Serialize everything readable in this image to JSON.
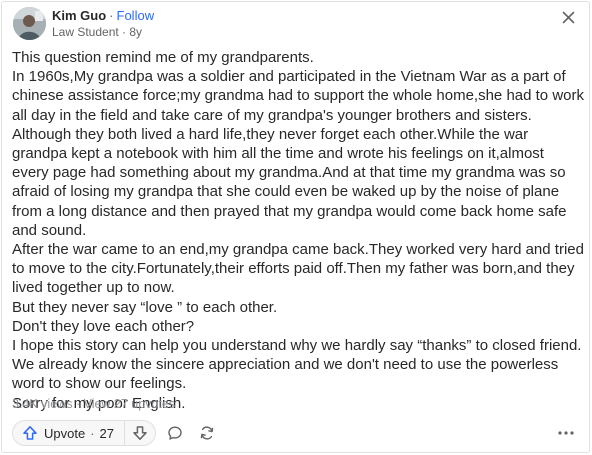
{
  "header": {
    "author_name": "Kim Guo",
    "separator": "·",
    "follow_label": "Follow",
    "credential": "Law Student · 8y"
  },
  "content": {
    "paragraphs": [
      "This question remind me of my grandparents.",
      "In 1960s,My grandpa was a soldier and participated in the Vietnam War as a part of chinese assistance force;my grandma had to support the whole home,she had to work all day in the field and take care of my grandpa's younger brothers and sisters.",
      "Although they both lived a hard life,they never forget each other.While the war grandpa kept a notebook with him all the time and wrote his feelings on it,almost every page had something about my grandma.And at that time my grandma was so afraid of losing my grandpa that she could even be waked up by the noise of plane from a long distance and then prayed that my grandpa would come back home safe and sound.",
      "After the war came to an end,my grandpa came back.They worked very hard and tried to move to the city.Fortunately,their efforts paid off.Then my father was born,and they lived together up to now.",
      "But they never say “love ” to each other.",
      "Don't they love each other?",
      "I hope this story can help you understand why we hardly say “thanks” to closed friend. We already know the sincere appreciation and we don't need to use the powerless word to show our feelings.",
      "Sorry for my poor English."
    ]
  },
  "stats": {
    "views": "3.4K views",
    "separator": "·",
    "upvotes_link": "View 27 upvotes"
  },
  "actions": {
    "upvote_label": "Upvote",
    "separator": "·",
    "upvote_count": "27"
  },
  "colors": {
    "text": "#282829",
    "muted": "#636466",
    "link": "#2e69ff",
    "border": "#dee0e1"
  }
}
